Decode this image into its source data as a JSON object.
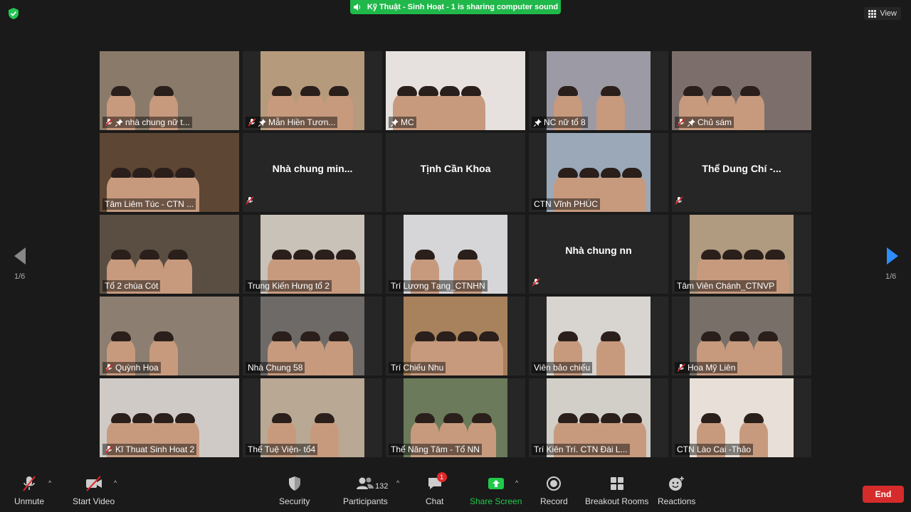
{
  "app": {
    "sharing_banner": "Kỹ Thuật - Sinh Hoạt - 1 is sharing computer sound",
    "view_label": "View",
    "page_indicator_left": "1/6",
    "page_indicator_right": "1/6"
  },
  "tiles": [
    {
      "name": "nhà chung nữ t...",
      "muted": true,
      "pinned": true,
      "video": true,
      "bg": "#8a7a6a"
    },
    {
      "name": "Mẫn Hiền Tươn...",
      "muted": true,
      "pinned": true,
      "video": true,
      "bg": "#b59a7c"
    },
    {
      "name": "MC",
      "muted": false,
      "pinned": true,
      "video": true,
      "active": true,
      "bg": "#e6e1de"
    },
    {
      "name": "NC nữ tổ 8",
      "muted": false,
      "pinned": true,
      "video": true,
      "bg": "#9c9aa4"
    },
    {
      "name": "Chủ sám",
      "muted": true,
      "pinned": true,
      "video": true,
      "bg": "#7c6e6a"
    },
    {
      "name": "Tâm Liêm Túc - CTN ...",
      "muted": false,
      "video": true,
      "bg": "#5e4634"
    },
    {
      "name": "Nhà chung min...",
      "muted": true,
      "video": false
    },
    {
      "name": "Tịnh Cần Khoa",
      "muted": false,
      "video": false
    },
    {
      "name": "CTN Vĩnh PHÚC",
      "muted": false,
      "video": true,
      "bg": "#9aa8b8"
    },
    {
      "name": "Thể Dung Chí -...",
      "muted": true,
      "video": false
    },
    {
      "name": "Tổ 2 chùa Cót",
      "muted": false,
      "video": true,
      "bg": "#5a4e42"
    },
    {
      "name": "Trung Kiến Hưng tổ 2",
      "muted": false,
      "video": true,
      "bg": "#c8c2b8"
    },
    {
      "name": "Trí Lương Tạng_CTNHN",
      "muted": false,
      "video": true,
      "bg": "#d6d6d8"
    },
    {
      "name": "Nhà chung nn",
      "muted": true,
      "video": false
    },
    {
      "name": "Tâm Viên Chánh_CTNVP",
      "muted": false,
      "video": true,
      "bg": "#b09a80"
    },
    {
      "name": "Quỳnh Hoa",
      "muted": true,
      "video": true,
      "bg": "#8c7e70"
    },
    {
      "name": "Nhà Chung 58",
      "muted": false,
      "video": true,
      "bg": "#6e6a68"
    },
    {
      "name": "Trí Chiếu Nhu",
      "muted": false,
      "video": true,
      "bg": "#a8825c"
    },
    {
      "name": "Viên bảo chiếu",
      "muted": false,
      "video": true,
      "bg": "#d8d4d0"
    },
    {
      "name": "Hoa Mỹ Liên",
      "muted": true,
      "video": true,
      "bg": "#787068"
    },
    {
      "name": "Kĩ Thuat Sinh Hoat 2",
      "muted": true,
      "video": true,
      "bg": "#cfcac6"
    },
    {
      "name": "Thể Tuệ Viện- tổ4",
      "muted": false,
      "video": true,
      "bg": "#b8a894"
    },
    {
      "name": "Thể Năng Tâm - Tổ NN",
      "muted": false,
      "video": true,
      "bg": "#6a7a5a"
    },
    {
      "name": "Trí Kiên Trí. CTN Đài L...",
      "muted": false,
      "video": true,
      "bg": "#d2cec8"
    },
    {
      "name": "CTN Lào Cai -Thảo",
      "muted": false,
      "video": true,
      "bg": "#e8e0d8"
    }
  ],
  "toolbar": {
    "unmute": "Unmute",
    "start_video": "Start Video",
    "security": "Security",
    "participants": "Participants",
    "participants_count": "132",
    "chat": "Chat",
    "chat_badge": "1",
    "share_screen": "Share Screen",
    "record": "Record",
    "breakout_rooms": "Breakout Rooms",
    "reactions": "Reactions",
    "end": "End"
  },
  "colors": {
    "banner": "#20b84a",
    "share_screen": "#20c94a",
    "end": "#d62b2b",
    "active_speaker": "#c8e84a",
    "muted_icon": "#e02828"
  }
}
